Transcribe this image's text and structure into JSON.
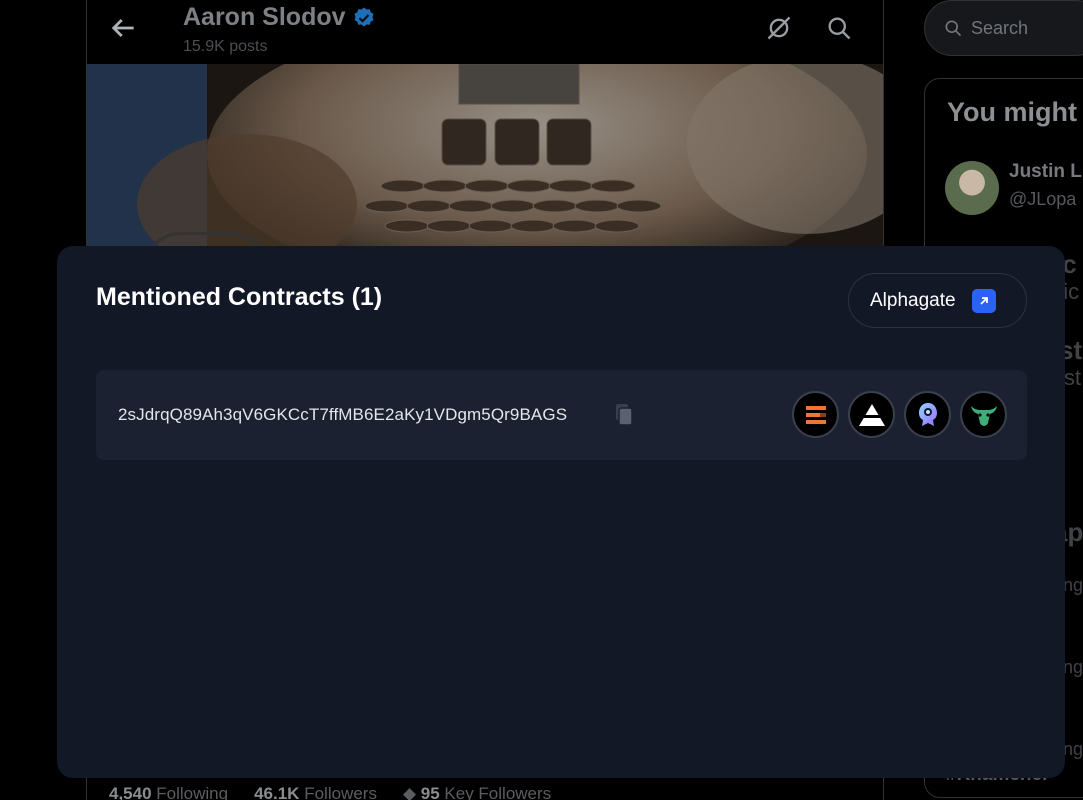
{
  "background": {
    "profile": {
      "name": "Aaron Slodov",
      "posts": "15.9K posts",
      "stats": {
        "following_count": "4,540",
        "following_label": "Following",
        "followers_count": "46.1K",
        "followers_label": "Followers",
        "key_followers_count": "95",
        "key_followers_label": "Key Followers"
      }
    },
    "sidebar": {
      "search_placeholder": "Search",
      "wtf_title": "You might",
      "suggestion": {
        "name": "Justin L",
        "handle": "@JLopa"
      },
      "ghost_fragments": [
        "ic",
        "nic",
        "ste",
        "ist",
        "ap",
        "ng",
        "ng",
        "ng"
      ],
      "trend": "#Khamenei"
    }
  },
  "modal": {
    "title": "Mentioned Contracts (1)",
    "alphagate_label": "Alphagate",
    "contract": {
      "address": "2sJdrqQ89Ah3qV6GKCcT7ffMB6E2aKy1VDgm5Qr9BAGS"
    },
    "platform_icons": [
      "solscan-icon",
      "axiom-icon",
      "photon-icon",
      "bullx-icon"
    ],
    "colors": {
      "modal_bg": "#131826",
      "row_bg": "#1b2130",
      "accent": "#2a62f4"
    }
  }
}
